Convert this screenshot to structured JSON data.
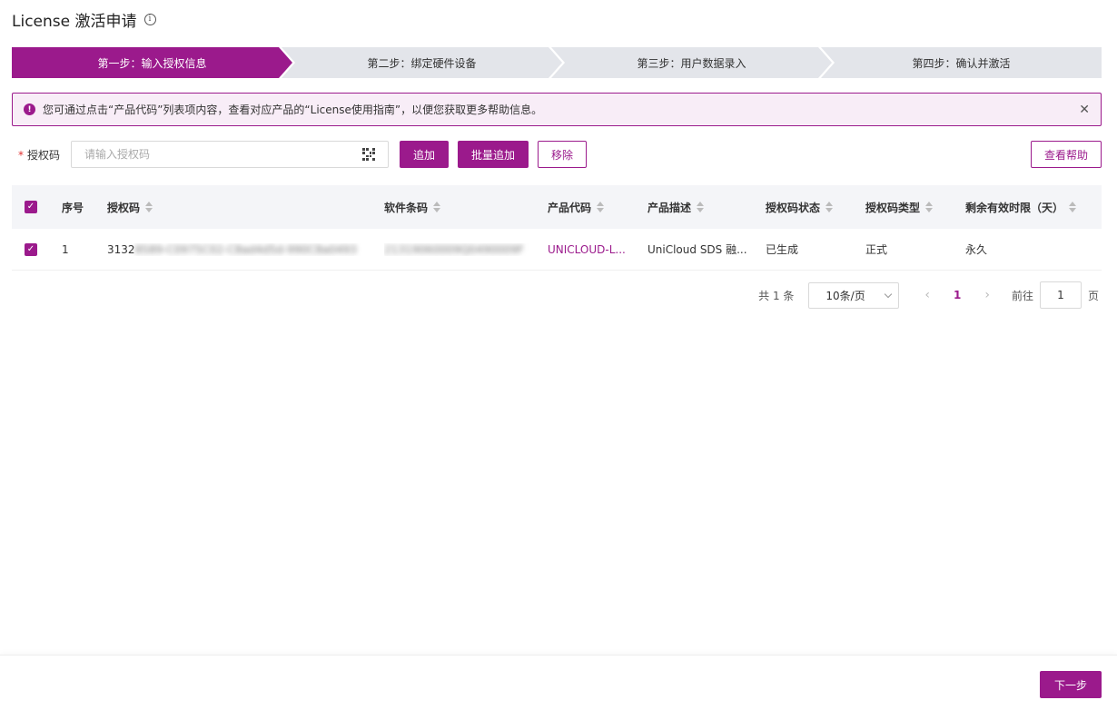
{
  "header": {
    "title": "License 激活申请"
  },
  "steps": [
    {
      "label": "第一步：输入授权信息",
      "active": true
    },
    {
      "label": "第二步：绑定硬件设备",
      "active": false
    },
    {
      "label": "第三步：用户数据录入",
      "active": false
    },
    {
      "label": "第四步：确认并激活",
      "active": false
    }
  ],
  "alert": {
    "icon": "!",
    "text": "您可通过点击“产品代码”列表项内容，查看对应产品的“License使用指南”，以便您获取更多帮助信息。",
    "close": "✕"
  },
  "form": {
    "label": "授权码",
    "required_mark": "*",
    "placeholder": "请输入授权码",
    "add_button": "追加",
    "batch_add_button": "批量追加",
    "remove_button": "移除",
    "help_button": "查看帮助"
  },
  "table": {
    "columns": [
      "序号",
      "授权码",
      "软件条码",
      "产品代码",
      "产品描述",
      "授权码状态",
      "授权码类型",
      "剩余有效时限（天）"
    ],
    "rows": [
      {
        "no": "1",
        "code_visible": "3132",
        "code_blurred": "8589-C0975C02-C8ad4d5d-990C8a0493",
        "sw_blurred": "21319060009Q0490009F",
        "product_code": "UNICLOUD-L...",
        "description": "UniCloud SDS 融...",
        "status": "已生成",
        "type": "正式",
        "remaining": "永久"
      }
    ]
  },
  "pager": {
    "total": "共 1 条",
    "page_size": "10条/页",
    "prev": "‹",
    "current": "1",
    "next": "›",
    "goto_label": "前往",
    "goto_value": "1",
    "page_suffix": "页"
  },
  "footer": {
    "next_button": "下一步"
  },
  "colors": {
    "accent": "#9b1a8c",
    "alert_bg": "#f8edf7"
  }
}
